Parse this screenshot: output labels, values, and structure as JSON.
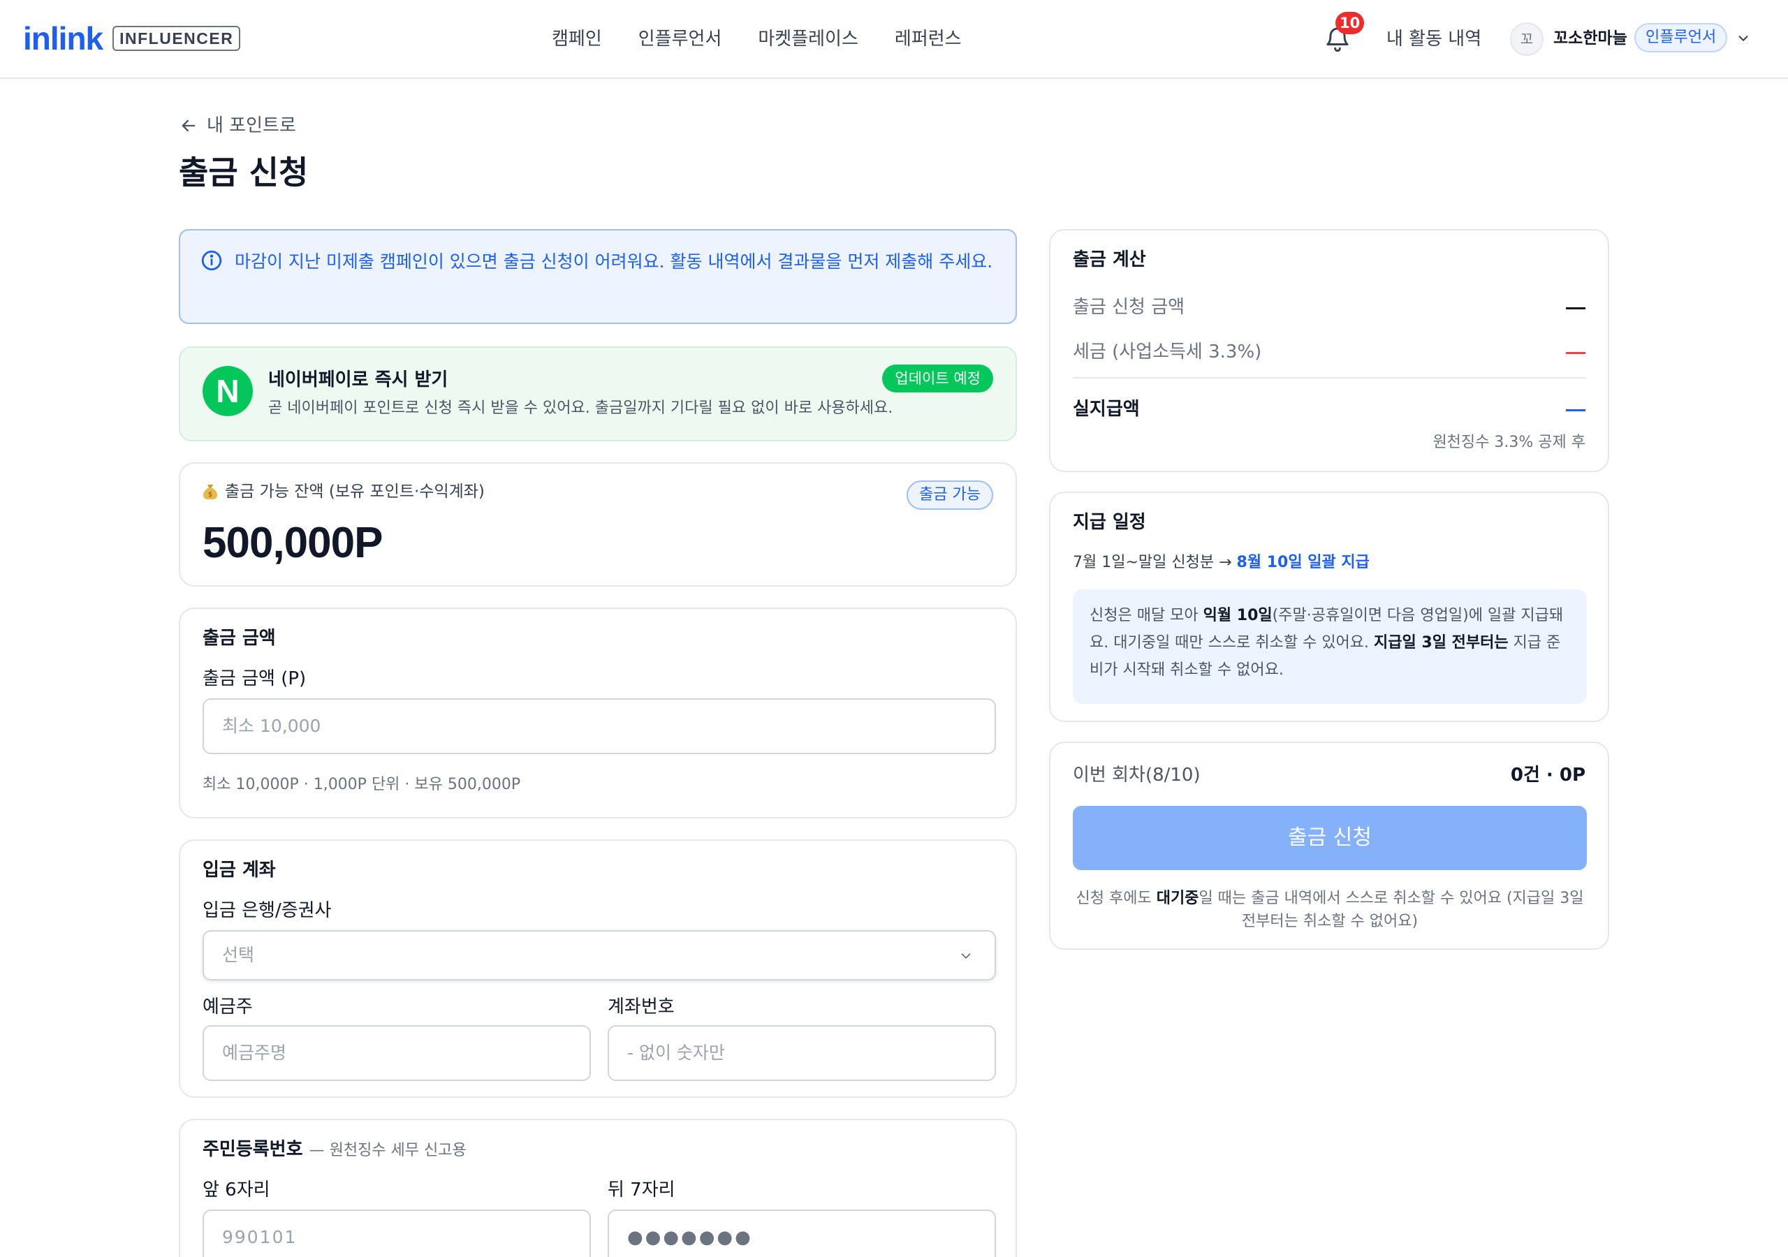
{
  "header": {
    "logo_word": "inlink",
    "logo_tag": "INFLUENCER",
    "nav": [
      "캠페인",
      "인플루언서",
      "마켓플레이스",
      "레퍼런스"
    ],
    "notification_count": "10",
    "activity_label": "내 활동 내역",
    "avatar_initial": "꼬",
    "username": "꼬소한마늘",
    "role": "인플루언서"
  },
  "page": {
    "back_label": "내 포인트로",
    "title": "출금 신청"
  },
  "notice": {
    "text": "마감이 지난 미제출 캠페인이 있으면 출금 신청이 어려워요. 활동 내역에서 결과물을 먼저 제출해 주세요."
  },
  "naverpay": {
    "logo": "N",
    "title": "네이버페이로 즉시 받기",
    "desc": "곧 네이버페이 포인트로 신청 즉시 받을 수 있어요. 출금일까지 기다릴 필요 없이 바로 사용하세요.",
    "badge": "업데이트 예정"
  },
  "balance": {
    "label": "출금 가능 잔액 (보유 포인트·수익계좌)",
    "value": "500,000P",
    "badge": "출금 가능"
  },
  "amount": {
    "section_title": "출금 금액",
    "field_label": "출금 금액 (P)",
    "placeholder": "최소 10,000",
    "hint": "최소 10,000P · 1,000P 단위 · 보유 500,000P"
  },
  "account": {
    "section_title": "입금 계좌",
    "bank_label": "입금 은행/증권사",
    "bank_value": "선택",
    "holder_label": "예금주",
    "holder_placeholder": "예금주명",
    "number_label": "계좌번호",
    "number_placeholder": "- 없이 숫자만"
  },
  "rrn": {
    "section_title": "주민등록번호",
    "section_sub": "— 원천징수 세무 신고용",
    "front_label": "앞 6자리",
    "front_placeholder": "990101",
    "back_label": "뒤 7자리",
    "back_placeholder": "●●●●●●●"
  },
  "calc": {
    "title": "출금 계산",
    "request_label": "출금 신청 금액",
    "tax_label": "세금 (사업소득세 3.3%)",
    "net_label": "실지급액",
    "foot": "원천징수 3.3% 공제 후",
    "colors": {
      "request": "#111827",
      "tax": "#ef4444",
      "net": "#1d5ff0"
    }
  },
  "schedule": {
    "title": "지급 일정",
    "period": "7월 1일~말일 신청분 →",
    "pay_date": "8월 10일 일괄 지급",
    "box_1": "신청은 매달 모아 ",
    "box_b1": "익월 10일",
    "box_2": "(주말·공휴일이면 다음 영업일)에 일괄 지급돼요. 대기중일 때만 스스로 취소할 수 있어요. ",
    "box_b2": "지급일 3일 전부터는",
    "box_3": " 지급 준비가 시작돼 취소할 수 없어요."
  },
  "submit": {
    "round_label": "이번 회차(8/10)",
    "round_value": "0건 · 0P",
    "button": "출금 신청",
    "note_1": "신청 후에도 ",
    "note_b": "대기중",
    "note_2": "일 때는 출금 내역에서 스스로 취소할 수 있어요 (지급일 3일 전부터는 취소할 수 없어요)"
  },
  "colors": {
    "brand": "#1d5ff0",
    "naver": "#03c75a",
    "alert": "#ef2b2b",
    "button_disabled": "#85b1fa"
  }
}
